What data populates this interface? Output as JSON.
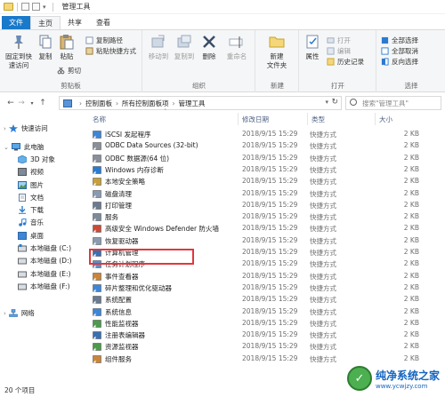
{
  "window": {
    "title": "管理工具"
  },
  "ribbon_tabs": [
    "文件",
    "主页",
    "共享",
    "查看"
  ],
  "ribbon": {
    "clipboard": {
      "label": "剪贴板",
      "pin": "固定到快\n速访问",
      "copy": "复制",
      "paste": "粘贴",
      "copy_path": "复制路径",
      "paste_shortcut": "粘贴快捷方式",
      "cut": "剪切"
    },
    "organize": {
      "label": "组织",
      "move_to": "移动到",
      "copy_to": "复制到",
      "delete": "删除",
      "rename": "重命名"
    },
    "new": {
      "label": "新建",
      "new_folder": "新建\n文件夹"
    },
    "open": {
      "label": "打开",
      "properties": "属性",
      "open": "打开",
      "edit": "编辑",
      "history": "历史记录"
    },
    "select": {
      "label": "选择",
      "select_all": "全部选择",
      "select_none": "全部取消",
      "invert": "反向选择"
    }
  },
  "address": {
    "crumbs": [
      "控制面板",
      "所有控制面板项",
      "管理工具"
    ],
    "search_placeholder": "搜索\"管理工具\""
  },
  "nav": {
    "quick_access": "快速访问",
    "this_pc": "此电脑",
    "items": [
      "3D 对象",
      "视频",
      "图片",
      "文档",
      "下载",
      "音乐",
      "桌面",
      "本地磁盘 (C:)",
      "本地磁盘 (D:)",
      "本地磁盘 (E:)",
      "本地磁盘 (F:)"
    ],
    "network": "网络"
  },
  "columns": {
    "name": "名称",
    "date": "修改日期",
    "type": "类型",
    "size": "大小"
  },
  "files": [
    {
      "name": "iSCSI 发起程序",
      "date": "2018/9/15 15:29",
      "type": "快捷方式",
      "size": "2 KB"
    },
    {
      "name": "ODBC Data Sources (32-bit)",
      "date": "2018/9/15 15:29",
      "type": "快捷方式",
      "size": "2 KB"
    },
    {
      "name": "ODBC 数据源(64 位)",
      "date": "2018/9/15 15:29",
      "type": "快捷方式",
      "size": "2 KB"
    },
    {
      "name": "Windows 内存诊断",
      "date": "2018/9/15 15:29",
      "type": "快捷方式",
      "size": "2 KB"
    },
    {
      "name": "本地安全策略",
      "date": "2018/9/15 15:29",
      "type": "快捷方式",
      "size": "2 KB"
    },
    {
      "name": "磁盘清理",
      "date": "2018/9/15 15:29",
      "type": "快捷方式",
      "size": "2 KB"
    },
    {
      "name": "打印管理",
      "date": "2018/9/15 15:29",
      "type": "快捷方式",
      "size": "2 KB"
    },
    {
      "name": "服务",
      "date": "2018/9/15 15:29",
      "type": "快捷方式",
      "size": "2 KB"
    },
    {
      "name": "高级安全 Windows Defender 防火墙",
      "date": "2018/9/15 15:29",
      "type": "快捷方式",
      "size": "2 KB"
    },
    {
      "name": "恢复驱动器",
      "date": "2018/9/15 15:29",
      "type": "快捷方式",
      "size": "2 KB"
    },
    {
      "name": "计算机管理",
      "date": "2018/9/15 15:29",
      "type": "快捷方式",
      "size": "2 KB"
    },
    {
      "name": "任务计划程序",
      "date": "2018/9/15 15:29",
      "type": "快捷方式",
      "size": "2 KB"
    },
    {
      "name": "事件查看器",
      "date": "2018/9/15 15:29",
      "type": "快捷方式",
      "size": "2 KB"
    },
    {
      "name": "碎片整理和优化驱动器",
      "date": "2018/9/15 15:29",
      "type": "快捷方式",
      "size": "2 KB"
    },
    {
      "name": "系统配置",
      "date": "2018/9/15 15:29",
      "type": "快捷方式",
      "size": "2 KB"
    },
    {
      "name": "系统信息",
      "date": "2018/9/15 15:29",
      "type": "快捷方式",
      "size": "2 KB"
    },
    {
      "name": "性能监视器",
      "date": "2018/9/15 15:29",
      "type": "快捷方式",
      "size": "2 KB"
    },
    {
      "name": "注册表编辑器",
      "date": "2018/9/15 15:29",
      "type": "快捷方式",
      "size": "2 KB"
    },
    {
      "name": "资源监视器",
      "date": "2018/9/15 15:29",
      "type": "快捷方式",
      "size": "2 KB"
    },
    {
      "name": "组件服务",
      "date": "2018/9/15 15:29",
      "type": "快捷方式",
      "size": "2 KB"
    }
  ],
  "status": {
    "count": "20 个项目"
  },
  "watermark": {
    "title": "纯净系统之家",
    "url": "www.ycwjzy.com"
  },
  "colors": {
    "accent": "#1979ca",
    "highlight_box": "#e0383d",
    "folder": "#f3d77a"
  }
}
